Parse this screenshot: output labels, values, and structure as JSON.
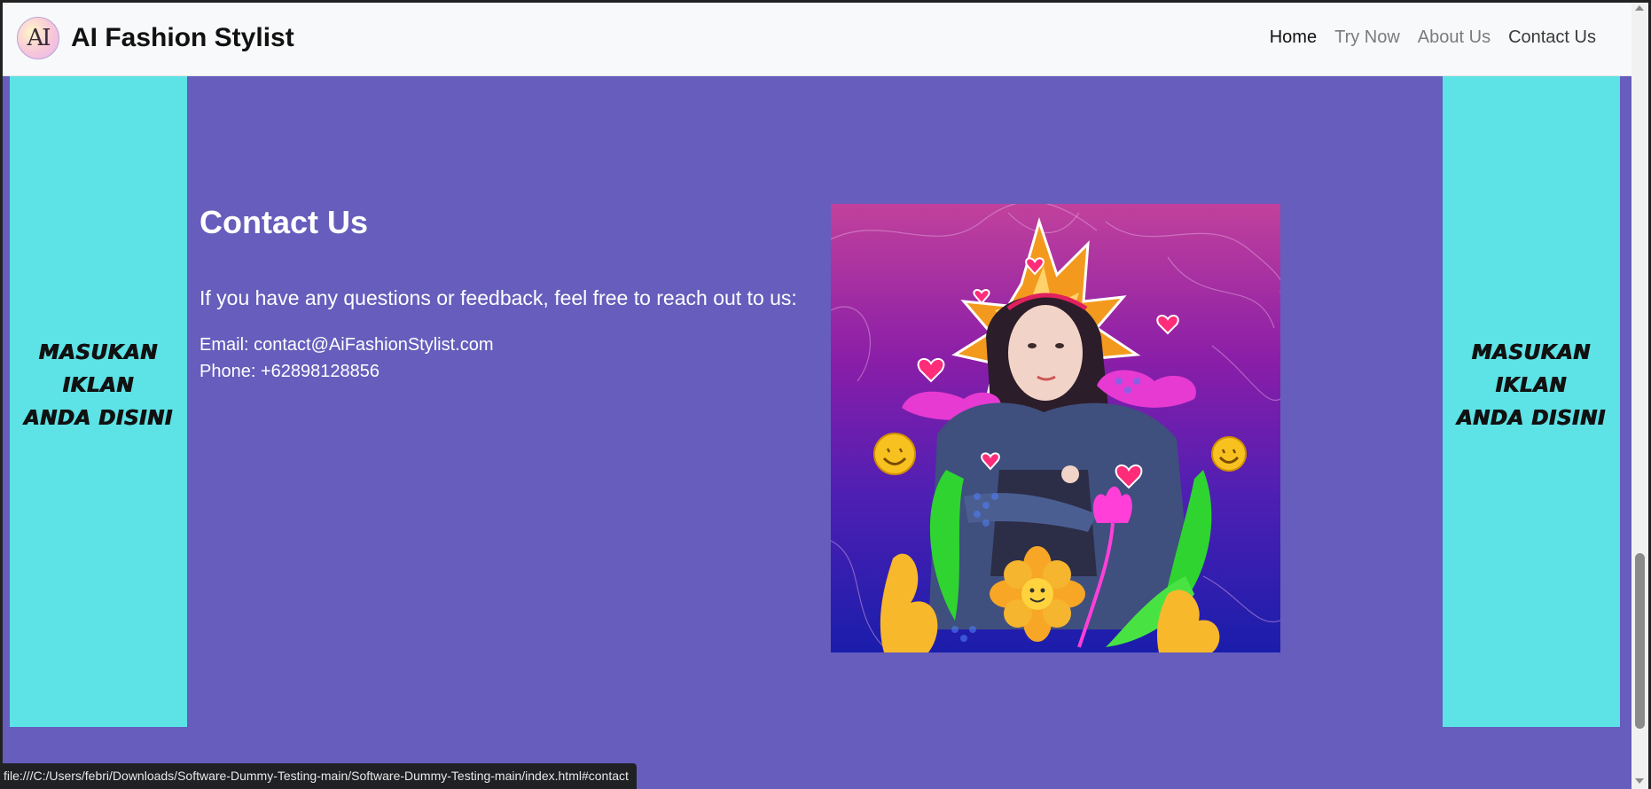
{
  "brand": {
    "logo_text": "AI",
    "name": "AI Fashion Stylist"
  },
  "nav": {
    "items": [
      {
        "label": "Home"
      },
      {
        "label": "Try Now"
      },
      {
        "label": "About Us"
      },
      {
        "label": "Contact Us"
      }
    ]
  },
  "ads": {
    "left": {
      "line1": "MASUKAN IKLAN",
      "line2": "ANDA DISINI"
    },
    "right": {
      "line1": "MASUKAN IKLAN",
      "line2": "ANDA DISINI"
    }
  },
  "contact": {
    "title": "Contact Us",
    "intro": "If you have any questions or feedback, feel free to reach out to us:",
    "email": "Email: contact@AiFashionStylist.com",
    "phone": "Phone: +62898128856"
  },
  "image": {
    "name": "fashion-girl-illustration"
  },
  "status_bar": {
    "url": "file:///C:/Users/febri/Downloads/Software-Dummy-Testing-main/Software-Dummy-Testing-main/index.html#contact"
  },
  "colors": {
    "page_bg": "#665dbc",
    "ad_bg": "#5de2e5",
    "navbar_bg": "#f8f9fa",
    "text_white": "#ffffff"
  }
}
